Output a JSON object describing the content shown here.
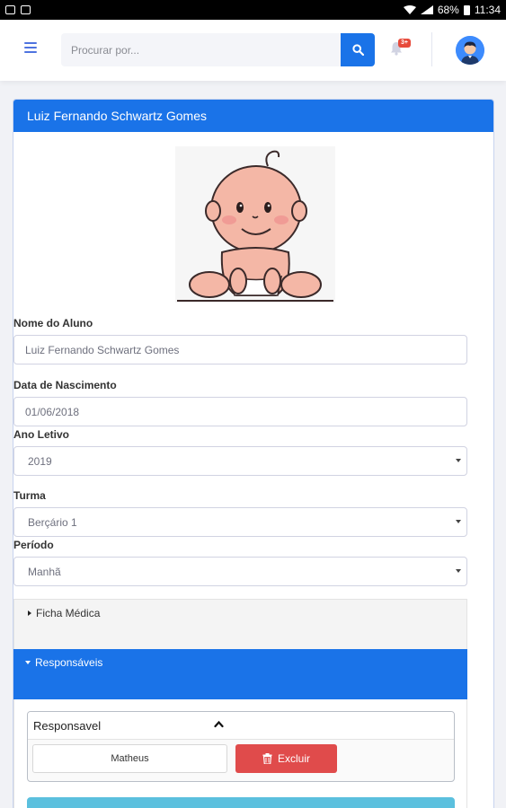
{
  "status_bar": {
    "battery": "68%",
    "time": "11:34"
  },
  "topbar": {
    "search_placeholder": "Procurar por...",
    "notification_badge": "3+"
  },
  "card": {
    "title": "Luiz Fernando Schwartz Gomes"
  },
  "form": {
    "nome_label": "Nome do Aluno",
    "nome_value": "Luiz Fernando Schwartz Gomes",
    "nascimento_label": "Data de Nascimento",
    "nascimento_value": "01/06/2018",
    "ano_label": "Ano Letivo",
    "ano_value": "2019",
    "turma_label": "Turma",
    "turma_value": "Berçário 1",
    "periodo_label": "Período",
    "periodo_value": "Manhã"
  },
  "accordion": {
    "ficha_medica": "Ficha Médica",
    "responsaveis": "Responsáveis"
  },
  "responsavel": {
    "header": "Responsavel",
    "name": "Matheus",
    "delete_label": "Excluir"
  },
  "colors": {
    "primary": "#1a73e8",
    "danger": "#e04b4b",
    "info": "#5bc0de"
  }
}
